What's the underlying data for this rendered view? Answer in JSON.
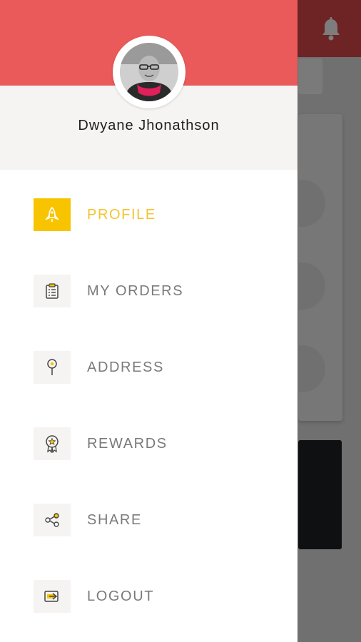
{
  "user": {
    "name": "Dwyane Jhonathson"
  },
  "menu": {
    "items": [
      {
        "label": "PROFILE",
        "icon": "rocket-icon",
        "active": true
      },
      {
        "label": "MY ORDERS",
        "icon": "clipboard-icon",
        "active": false
      },
      {
        "label": "ADDRESS",
        "icon": "location-pin-icon",
        "active": false
      },
      {
        "label": "REWARDS",
        "icon": "award-badge-icon",
        "active": false
      },
      {
        "label": "SHARE",
        "icon": "share-icon",
        "active": false
      },
      {
        "label": "LOGOUT",
        "icon": "logout-icon",
        "active": false
      }
    ]
  },
  "colors": {
    "header": "#ea5a5a",
    "accent": "#f8c400",
    "inactive_text": "#7a7a7a"
  }
}
